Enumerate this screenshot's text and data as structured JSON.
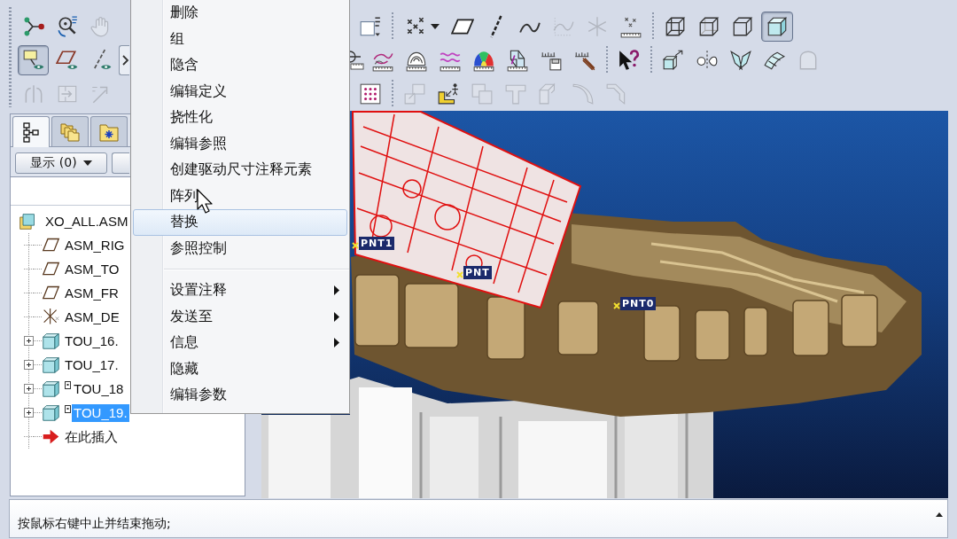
{
  "toolbar": {
    "left": [
      [
        [
          {
            "disabled": false
          },
          {
            "disabled": false
          },
          {
            "disabled": true
          }
        ]
      ],
      [
        [
          {
            "selected": true
          },
          {
            "selected": false
          },
          {
            "selected": false
          }
        ],
        [
          {
            "disabled": false
          }
        ]
      ],
      [
        [
          {
            "disabled": true
          },
          {
            "disabled": true
          },
          {
            "disabled": true
          }
        ]
      ]
    ],
    "right": [
      [
        [
          {
            "disabled": false
          }
        ],
        [
          {
            "disabled": false
          },
          {
            "disabled": false
          },
          {
            "disabled": false
          },
          {
            "disabled": false
          },
          {
            "disabled": true
          },
          {
            "disabled": true
          },
          {
            "disabled": false
          }
        ],
        [
          {
            "selected": false
          },
          {
            "selected": false
          },
          {
            "selected": false
          },
          {
            "selected": true
          }
        ]
      ],
      [
        [
          {
            "disabled": false
          },
          {
            "disabled": false
          },
          {
            "disabled": false
          },
          {
            "disabled": false
          },
          {
            "disabled": false
          },
          {
            "disabled": false
          },
          {
            "disabled": false
          },
          {
            "disabled": false
          }
        ],
        [
          {
            "disabled": false
          }
        ],
        [
          {
            "disabled": false
          },
          {
            "disabled": false
          },
          {
            "disabled": false
          },
          {
            "disabled": false
          },
          {
            "disabled": true
          }
        ]
      ],
      [
        [
          {
            "disabled": false
          }
        ],
        [
          {
            "disabled": true
          },
          {
            "disabled": false
          },
          {
            "disabled": true
          },
          {
            "disabled": true
          },
          {
            "disabled": true
          },
          {
            "disabled": true
          },
          {
            "disabled": true
          }
        ]
      ]
    ]
  },
  "panel_tabs": [
    {
      "selected": true
    },
    {
      "selected": false
    },
    {
      "selected": false
    }
  ],
  "panel_buttons": {
    "show_label": "显示 (0)"
  },
  "tree": [
    {
      "label": "XO_ALL.ASM",
      "kind": "assembly",
      "selected": false,
      "children": [
        {
          "label": "ASM_RIG",
          "kind": "plane",
          "selected": false
        },
        {
          "label": "ASM_TO",
          "kind": "plane",
          "selected": false
        },
        {
          "label": "ASM_FR",
          "kind": "plane",
          "selected": false
        },
        {
          "label": "ASM_DE",
          "kind": "csys",
          "selected": false
        },
        {
          "label": "TOU_16.",
          "kind": "part",
          "selected": false,
          "expanded": false,
          "marked": false
        },
        {
          "label": "TOU_17.",
          "kind": "part",
          "selected": false,
          "expanded": false,
          "marked": false
        },
        {
          "label": "TOU_18",
          "kind": "part",
          "selected": false,
          "expanded": false,
          "marked": true
        },
        {
          "label": "TOU_19.",
          "kind": "part",
          "selected": true,
          "expanded": false,
          "marked": true
        },
        {
          "label": "在此插入",
          "kind": "insert",
          "selected": false
        }
      ]
    }
  ],
  "context_menu": {
    "groups": [
      [
        {
          "label": "删除",
          "selected": false,
          "submenu": false
        },
        {
          "label": "组",
          "selected": false,
          "submenu": false
        },
        {
          "label": "隐含",
          "selected": false,
          "submenu": false
        },
        {
          "label": "编辑定义",
          "selected": false,
          "submenu": false
        },
        {
          "label": "挠性化",
          "selected": false,
          "submenu": false
        },
        {
          "label": "编辑参照",
          "selected": false,
          "submenu": false
        },
        {
          "label": "创建驱动尺寸注释元素",
          "selected": false,
          "submenu": false
        },
        {
          "label": "阵列",
          "selected": false,
          "submenu": false
        },
        {
          "label": "替换",
          "selected": true,
          "submenu": false
        },
        {
          "label": "参照控制",
          "selected": false,
          "submenu": false
        }
      ],
      [
        {
          "label": "设置注释",
          "selected": false,
          "submenu": true
        },
        {
          "label": "发送至",
          "selected": false,
          "submenu": true
        },
        {
          "label": "信息",
          "selected": false,
          "submenu": true
        },
        {
          "label": "隐藏",
          "selected": false,
          "submenu": false
        },
        {
          "label": "编辑参数",
          "selected": false,
          "submenu": false
        }
      ]
    ]
  },
  "viewport": {
    "datum_points": [
      {
        "label": "PNT1"
      },
      {
        "label": "PNT"
      },
      {
        "label": "PNT0"
      }
    ]
  },
  "status_bar": {
    "messages": [
      "按鼠标右键中止并结束拖动;"
    ]
  }
}
